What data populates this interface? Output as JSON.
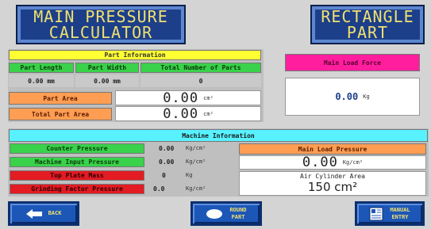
{
  "header": {
    "left_button": {
      "line1": "MAIN PRESSURE",
      "line2": "CALCULATOR"
    },
    "right_button": {
      "line1": "RECTANGLE",
      "line2": "PART"
    }
  },
  "part_info": {
    "title": "Part Information",
    "col_length": "Part Length",
    "col_width": "Part Width",
    "col_total": "Total Number of Parts",
    "length_value": "0.00 mm",
    "width_value": "0.00 mm",
    "total_value": "0",
    "part_area_label": "Part Area",
    "part_area_value": "0.00",
    "part_area_unit": "cm²",
    "total_area_label": "Total Part Area",
    "total_area_value": "0.00",
    "total_area_unit": "cm²"
  },
  "main_load": {
    "label": "Main Load Force",
    "value": "0.00",
    "unit": "Kg"
  },
  "machine_info": {
    "title": "Machine Information",
    "rows": [
      {
        "label": "Counter Pressure",
        "value": "0.00",
        "unit": "Kg/cm²"
      },
      {
        "label": "Machine Input Pressure",
        "value": "0.00",
        "unit": "Kg/cm²"
      },
      {
        "label": "Top Plate Mass",
        "value": "0",
        "unit": "Kg"
      },
      {
        "label": "Grinding Factor Pressure",
        "value": "0.0",
        "unit": "Kg/cm²"
      }
    ],
    "main_load_pressure_label": "Main Load Pressure",
    "main_load_pressure_value": "0.00",
    "main_load_pressure_unit": "Kg/cm²",
    "air_cyl_label": "Air Cylinder Area",
    "air_cyl_value": "150 cm²"
  },
  "footer": {
    "back": "BACK",
    "round_line1": "ROUND",
    "round_line2": "PART",
    "manual_line1": "MANUAL",
    "manual_line2": "ENTRY"
  }
}
